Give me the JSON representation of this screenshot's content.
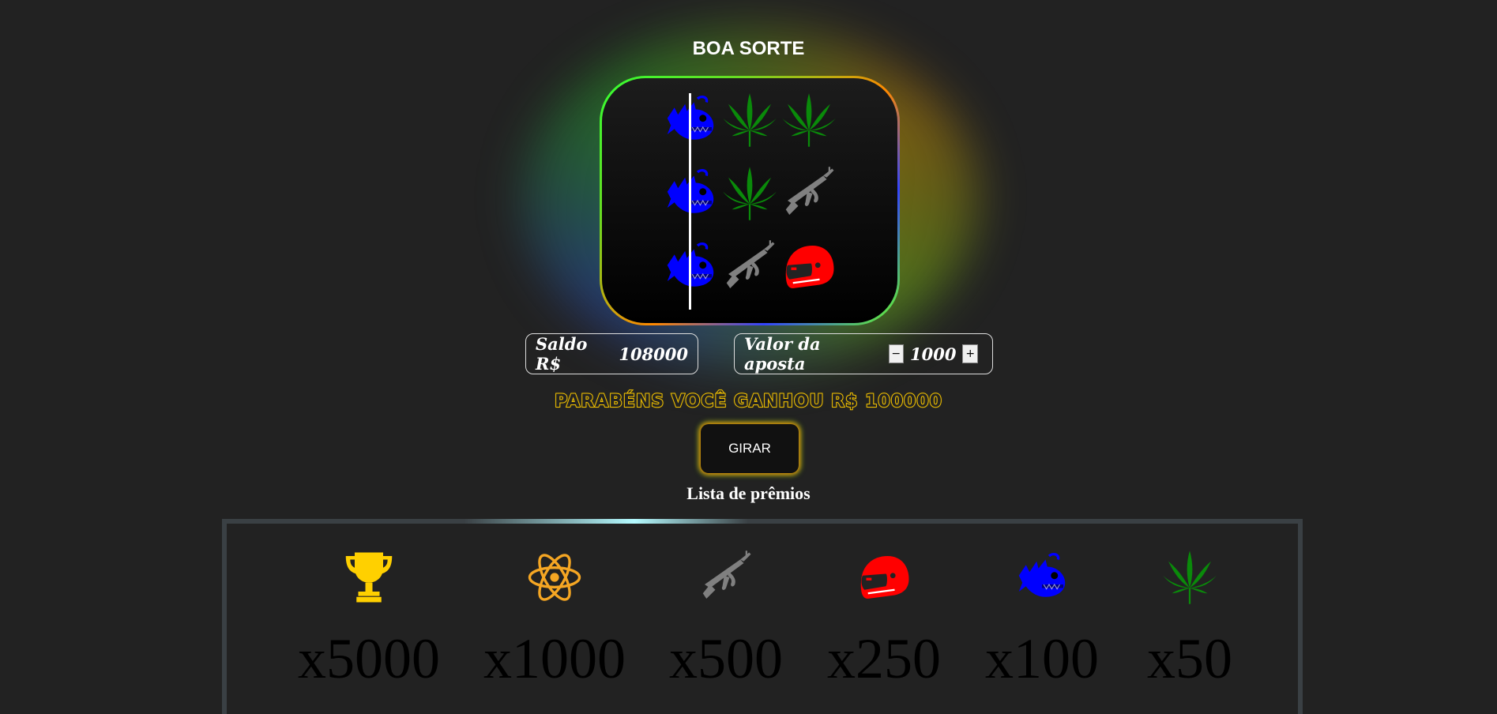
{
  "header": {
    "title": "BOA SORTE"
  },
  "reels": {
    "rows": [
      [
        "fish-icon",
        "leaf-icon",
        "leaf-icon"
      ],
      [
        "fish-icon",
        "leaf-icon",
        "rifle-icon"
      ],
      [
        "fish-icon",
        "rifle-icon",
        "helmet-icon"
      ]
    ]
  },
  "balance": {
    "label": "Saldo R$",
    "value": "108000"
  },
  "bet": {
    "label": "Valor da aposta",
    "decrement": "−",
    "value": "1000",
    "increment": "+"
  },
  "message": {
    "text": "PARABÉNS VOCÊ GANHOU R$ 100000"
  },
  "spin_button": {
    "label": "GIRAR"
  },
  "prizes": {
    "heading": "Lista de prêmios",
    "items": [
      {
        "icon": "trophy-icon",
        "multiplier": "x5000"
      },
      {
        "icon": "atom-icon",
        "multiplier": "x1000"
      },
      {
        "icon": "rifle-icon",
        "multiplier": "x500"
      },
      {
        "icon": "helmet-icon",
        "multiplier": "x250"
      },
      {
        "icon": "fish-icon",
        "multiplier": "x100"
      },
      {
        "icon": "leaf-icon",
        "multiplier": "x50"
      }
    ]
  },
  "colors": {
    "fish": "#0000ff",
    "leaf": "#0a8a0a",
    "rifle": "#808080",
    "helmet": "#ff0000",
    "trophy": "#ffd000",
    "atom": "#f5a623",
    "message": "#f0c000"
  }
}
